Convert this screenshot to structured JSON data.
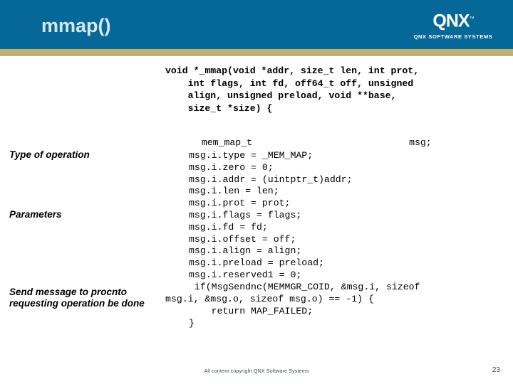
{
  "header": {
    "title": "mmap()",
    "band_color": "#056896",
    "stripe_color": "#bfb173",
    "title_color": "#d6e7f2",
    "logo": {
      "mark": "QNX",
      "trademark": "™",
      "tagline": "QNX SOFTWARE SYSTEMS"
    }
  },
  "code": {
    "signature": "void *_mmap(void *addr, size_t len, int prot,\n    int flags, int fd, off64_t off, unsigned\n    align, unsigned preload, void **base,\n    size_t *size) {",
    "declaration_type": "mem_map_t",
    "declaration_name": "msg;",
    "body": "msg.i.type = _MEM_MAP;\nmsg.i.zero = 0;\nmsg.i.addr = (uintptr_t)addr;\nmsg.i.len = len;\nmsg.i.prot = prot;\nmsg.i.flags = flags;\nmsg.i.fd = fd;\nmsg.i.offset = off;\nmsg.i.align = align;\nmsg.i.preload = preload;\nmsg.i.reserved1 = 0;\n if(MsgSendnc(MEMMGR_COID, &msg.i, sizeof",
    "wrapped_line": "msg.i, &msg.o, sizeof msg.o) == -1) {",
    "tail": "    return MAP_FAILED;\n}"
  },
  "annotations": {
    "type_of_operation": "Type of operation",
    "parameters": "Parameters",
    "send_message": "Send message to procnto\nrequesting operation be done"
  },
  "footer": {
    "copyright": "All content copyright QNX Software Systems",
    "page_number": "23"
  }
}
